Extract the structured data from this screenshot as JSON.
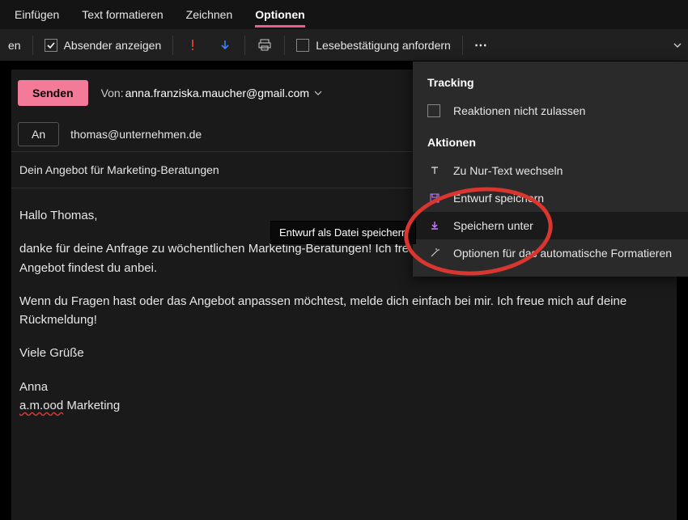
{
  "tabs": {
    "insert": "Einfügen",
    "format": "Text formatieren",
    "draw": "Zeichnen",
    "options": "Optionen"
  },
  "toolbar": {
    "edge_label": "en",
    "show_sender": "Absender anzeigen",
    "read_receipt": "Lesebestätigung anfordern",
    "more": "⋯"
  },
  "compose": {
    "send": "Senden",
    "from_label": "Von:",
    "from_email": "anna.franziska.maucher@gmail.com",
    "to_button": "An",
    "to_value": "thomas@unternehmen.de",
    "subject": "Dein Angebot für Marketing-Beratungen",
    "greeting": "Hallo Thomas,",
    "p1": "danke für deine Anfrage zu wöchentlichen Marketing-Beratungen! Ich freue mich dir ein Angebot erstellen zu dürfen. Das Angebot findest du anbei.",
    "p2": "Wenn du Fragen hast oder das Angebot anpassen möchtest, melde dich einfach bei mir. Ich freue mich auf deine Rückmeldung!",
    "signoff": "Viele Grüße",
    "sig_name": "Anna",
    "sig_company_err": "a.m.ood",
    "sig_company_rest": " Marketing"
  },
  "dropdown": {
    "tracking_heading": "Tracking",
    "reactions": "Reaktionen nicht zulassen",
    "actions_heading": "Aktionen",
    "to_plaintext": "Zu Nur-Text wechseln",
    "save_draft": "Entwurf speichern",
    "save_as": "Speichern unter",
    "autoformat": "Optionen für das automatische Formatieren"
  },
  "tooltip": {
    "save_as_file": "Entwurf als Datei speichern"
  }
}
